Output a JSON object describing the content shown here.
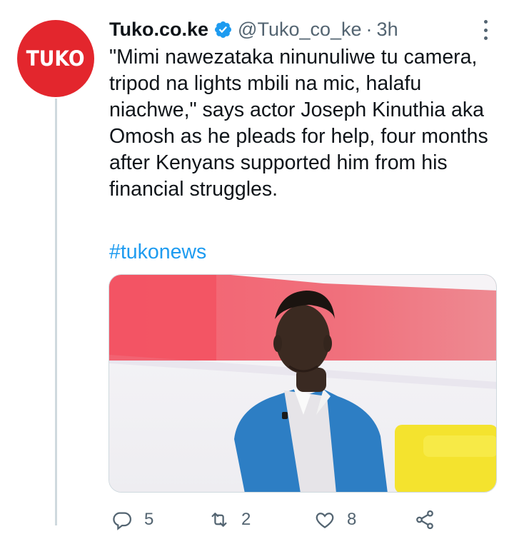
{
  "tweet": {
    "avatar_text": "TUKO",
    "display_name": "Tuko.co.ke",
    "handle": "@Tuko_co_ke",
    "separator": "·",
    "time": "3h",
    "text": "\"Mimi nawezataka ninunuliwe tu camera, tripod na lights mbili na mic, halafu niachwe,\" says actor Joseph Kinuthia aka Omosh as he pleads for help, four months after Kenyans supported him from his financial struggles.",
    "hashtag": "#tukonews",
    "replies": "5",
    "retweets": "2",
    "likes": "8"
  },
  "icons": {
    "verified": "verified-badge-icon",
    "more": "more-options-icon",
    "reply": "reply-icon",
    "retweet": "retweet-icon",
    "like": "heart-icon",
    "share": "share-icon"
  },
  "colors": {
    "accent": "#1d9bf0",
    "brand_red": "#e3262d",
    "muted_text": "#536471",
    "text": "#0f1419",
    "thread_line": "#cfd9de"
  }
}
